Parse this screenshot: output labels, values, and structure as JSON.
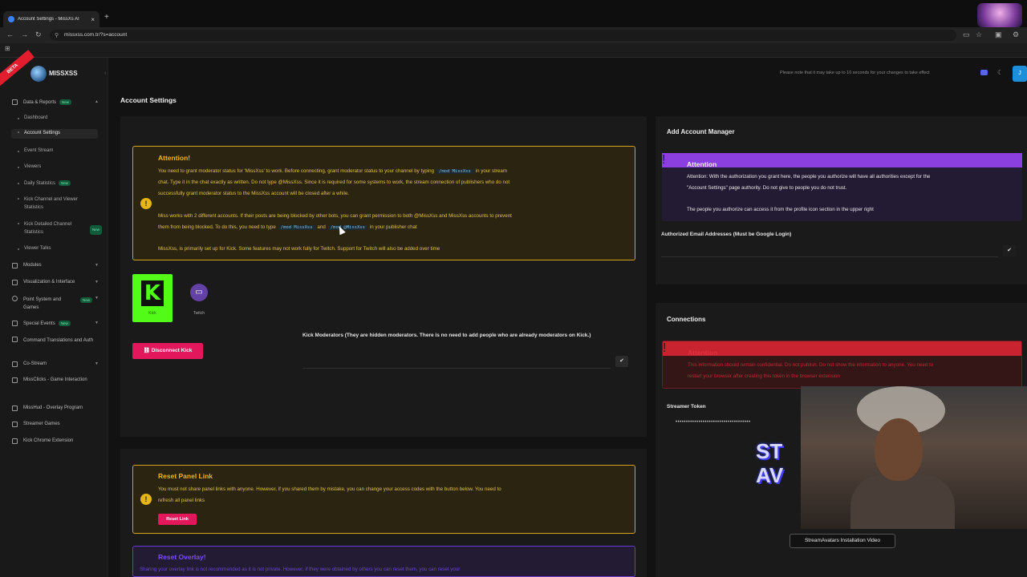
{
  "browser": {
    "tab_title": "Account Settings - MissXs AI",
    "tab_close": "×",
    "new_tab": "+",
    "url": "missxss.com.tr/?s=account"
  },
  "sidebar": {
    "beta": "BETA",
    "logo_text": "MISSXSS",
    "items": [
      {
        "label": "Data & Reports",
        "badge": "New"
      },
      {
        "label": "Modules"
      },
      {
        "label": "Visualization & Interface"
      },
      {
        "label": "Point System and Games",
        "badge": "New"
      },
      {
        "label": "Special Events",
        "badge": "New"
      },
      {
        "label": "Command Translations and Auth"
      },
      {
        "label": "Co-Stream"
      },
      {
        "label": "MissClicks - Game Interaction"
      },
      {
        "label": "MissHud - Overlay Program"
      },
      {
        "label": "Streamer Games"
      },
      {
        "label": "Kick Chrome Extension"
      }
    ],
    "subitems": [
      {
        "label": "Dashboard"
      },
      {
        "label": "Account Settings"
      },
      {
        "label": "Event Stream"
      },
      {
        "label": "Viewers"
      },
      {
        "label": "Daily Statistics",
        "badge": "New"
      },
      {
        "label": "Kick Channel and Viewer Statistics"
      },
      {
        "label": "Kick Detailed Channel Statistics",
        "badge": "New"
      },
      {
        "label": "Viewer Talks"
      }
    ]
  },
  "header": {
    "notice": "Please note that it may take up to 10 seconds for your changes to take effect",
    "user_initial": "J"
  },
  "page": {
    "title": "Account Settings"
  },
  "attention": {
    "title": "Attention!",
    "line1a": "You need to grant moderator status for 'MissXss' to work. Before connecting, grant moderator status to your channel by typing",
    "cmd1": "/mod MissXss",
    "line1b": "in your stream",
    "line2": "chat. Type it in the chat exactly as written. Do not type @MissXss. Since it is required for some systems to work, the stream connection of publishers who do not",
    "line3": "successfully grant moderator status to the MissXss account will be closed after a while.",
    "line4": "Miss works with 2 different accounts. If their posts are being blocked by other bots, you can grant permission to both @MissXss and MissXss accounts to prevent",
    "line5a": "them from being blocked. To do this, you need to type",
    "cmd2": "/mod MissXss",
    "and": "and",
    "cmd3": "/mod @MissXss",
    "line5b": "in your publisher chat",
    "line6": "MissXss, is primarily set up for Kick. Some features may not work fully for Twitch. Support for Twitch will also be added over time"
  },
  "platforms": {
    "kick_label": "Kick",
    "kick_letter": "K",
    "twitch_label": "Twitch",
    "disconnect_label": "Disconnect Kick"
  },
  "kick_moderators": {
    "label": "Kick Moderators (They are hidden moderators. There is no need to add people who are already moderators on Kick.)",
    "check": "✔"
  },
  "reset_panel": {
    "title": "Reset Panel Link",
    "line1": "You must not share panel links with anyone. However, if you shared them by mistake, you can change your access codes with the button below. You need to",
    "line2": "refresh all panel links",
    "button": "Reset Link"
  },
  "reset_overlay": {
    "title": "Reset Overlay!",
    "line1": "Sharing your overlay link is not recommended as it is not private. However, if they were obtained by others you can reset them, you can reset your"
  },
  "account_manager": {
    "title": "Add Account Manager",
    "attention_title": "Attention",
    "line1": "Attention: With the authorization you grant here, the people you authorize will have all authorities except for the",
    "line2": "\"Account Settings\" page authority. Do not give to people you do not trust.",
    "line3": "The people you authorize can access it from the profile icon section in the upper right",
    "emails_label": "Authorized Email Addresses (Must be Google Login)",
    "check": "✔"
  },
  "connections": {
    "title": "Connections",
    "attention_title": "Attention",
    "line1": "This information should remain confidential. Do not publish. Do not show the information to anyone. You need to",
    "line2": "restart your browser after creating this token in the browser extension",
    "token_label": "Streamer Token",
    "token_value": "••••••••••••••••••••••••••••••••••••"
  },
  "webcam": {
    "overlay_text": "ST AV",
    "caption": "StreamAvatars Installation Video"
  }
}
